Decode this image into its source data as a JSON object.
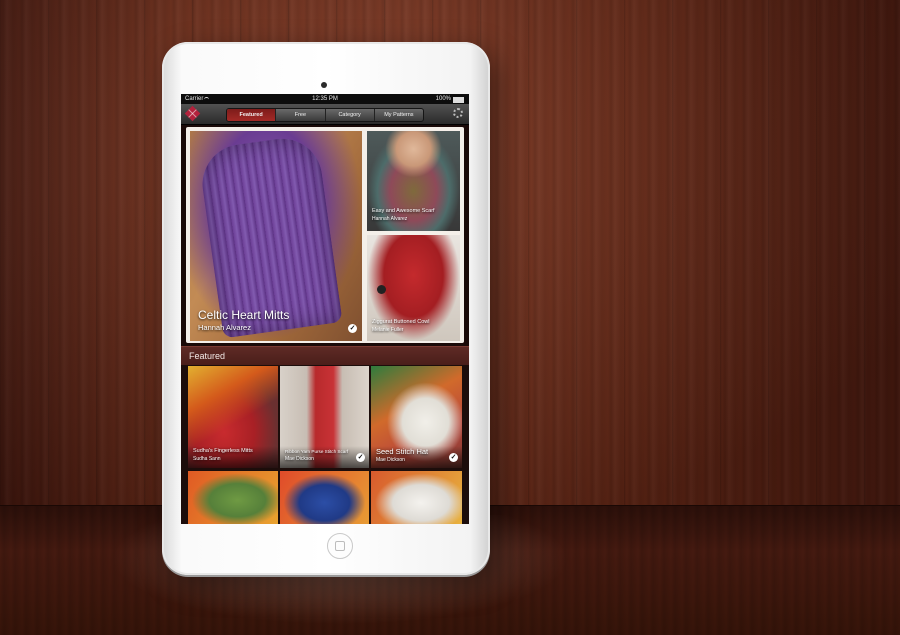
{
  "status_bar": {
    "carrier": "Carrier",
    "time": "12:35 PM",
    "battery": "100%"
  },
  "nav": {
    "tabs": [
      {
        "label": "Featured",
        "active": true
      },
      {
        "label": "Free",
        "active": false
      },
      {
        "label": "Category",
        "active": false
      },
      {
        "label": "My Patterns",
        "active": false
      }
    ]
  },
  "hero": {
    "main": {
      "title": "Celtic Heart Mitts",
      "author": "Hannah Alvarez"
    },
    "side_top": {
      "title": "Easy and Awesome Scarf",
      "author": "Hannah Alvarez"
    },
    "side_bottom": {
      "title": "Ziggurat Buttoned Cowl",
      "author": "Melanie Fuller"
    }
  },
  "featured": {
    "heading": "Featured",
    "items": [
      {
        "title": "Sudha's Fingerless Mitts",
        "author": "Sudha Sann"
      },
      {
        "title": "Ribbon Yarn Purse Stitch Scarf",
        "author": "Mae Dickson"
      },
      {
        "title": "Seed Stitch Hat",
        "author": "Mae Dickson"
      }
    ]
  },
  "colors": {
    "accent": "#a42a26",
    "wood": "#6e2c19"
  },
  "icons": [
    "logo-icon",
    "gear-icon",
    "check-icon",
    "wifi-icon",
    "battery-icon"
  ]
}
